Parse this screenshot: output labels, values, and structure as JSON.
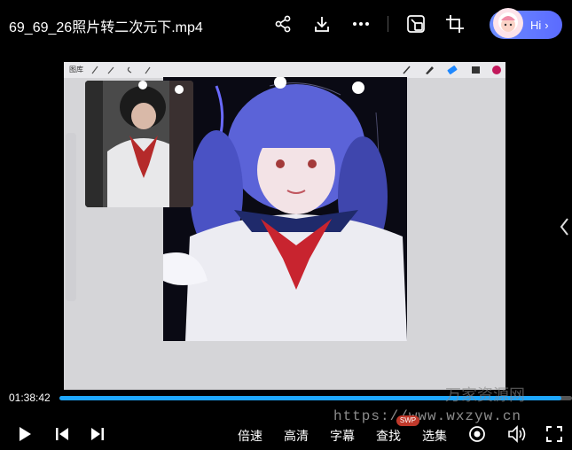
{
  "header": {
    "title": "69_69_26照片转二次元下.mp4",
    "ai_label": "Hi",
    "icons": [
      "share-icon",
      "download-icon",
      "more-icon",
      "picture-in-picture-icon",
      "crop-icon"
    ]
  },
  "video": {
    "app": {
      "gallery_label": "图库"
    }
  },
  "player": {
    "current_time": "01:38:42",
    "progress_fraction": 0.98,
    "buttons": {
      "speed": "倍速",
      "quality": "高清",
      "subtitle": "字幕",
      "search": "查找",
      "select": "选集"
    },
    "badge": "SWP"
  },
  "watermark": {
    "url": "https://www.wxzyw.cn",
    "brand": "万家资源网"
  },
  "colors": {
    "accent": "#1ea7ff",
    "pill": "#5b6bff"
  }
}
